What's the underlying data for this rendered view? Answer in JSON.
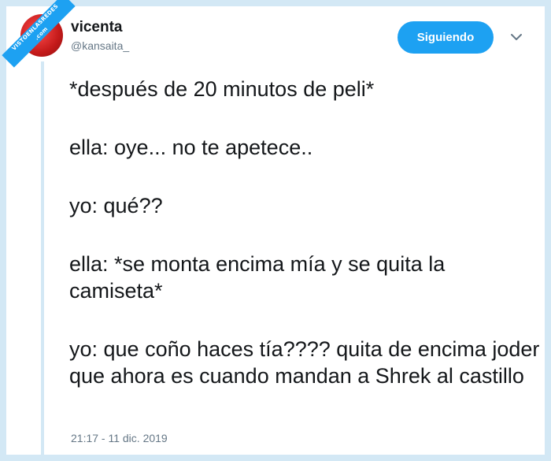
{
  "watermark": {
    "line1": "VISTOENLASREDES",
    "line2": ".com"
  },
  "user": {
    "name": "vicenta",
    "handle": "@kansaita_"
  },
  "follow_button": {
    "label": "Siguiendo"
  },
  "menu_icon": "chevron-down-icon",
  "tweet": {
    "paragraphs": [
      "*después de 20 minutos de peli*",
      "ella: oye... no te apetece..",
      "yo: qué??",
      "ella: *se monta encima mía y se quita la camiseta*",
      "yo: que coño haces tía???? quita de encima joder que ahora es cuando mandan a Shrek al castillo"
    ]
  },
  "timestamp": "21:17 - 11 dic. 2019",
  "colors": {
    "accent": "#1da1f2",
    "frame": "#d3e8f5",
    "text": "#14171a",
    "muted": "#657786"
  }
}
